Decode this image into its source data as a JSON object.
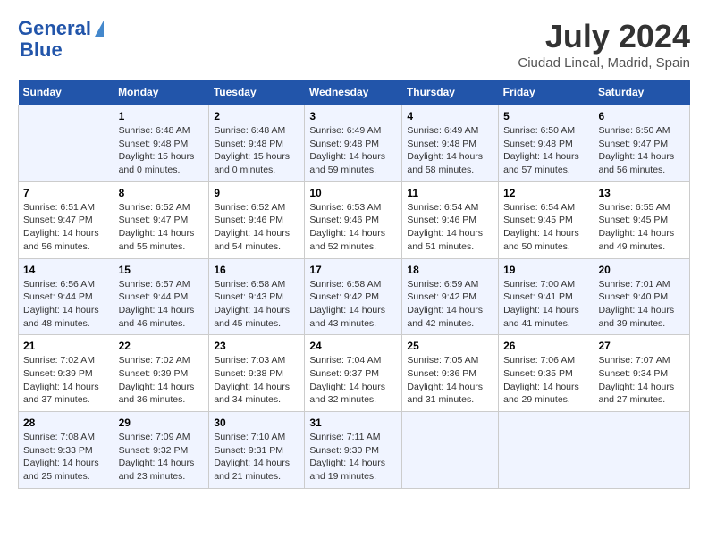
{
  "header": {
    "logo_line1": "General",
    "logo_line2": "Blue",
    "month_year": "July 2024",
    "location": "Ciudad Lineal, Madrid, Spain"
  },
  "days_of_week": [
    "Sunday",
    "Monday",
    "Tuesday",
    "Wednesday",
    "Thursday",
    "Friday",
    "Saturday"
  ],
  "weeks": [
    [
      {
        "day": "",
        "info": ""
      },
      {
        "day": "1",
        "info": "Sunrise: 6:48 AM\nSunset: 9:48 PM\nDaylight: 15 hours\nand 0 minutes."
      },
      {
        "day": "2",
        "info": "Sunrise: 6:48 AM\nSunset: 9:48 PM\nDaylight: 15 hours\nand 0 minutes."
      },
      {
        "day": "3",
        "info": "Sunrise: 6:49 AM\nSunset: 9:48 PM\nDaylight: 14 hours\nand 59 minutes."
      },
      {
        "day": "4",
        "info": "Sunrise: 6:49 AM\nSunset: 9:48 PM\nDaylight: 14 hours\nand 58 minutes."
      },
      {
        "day": "5",
        "info": "Sunrise: 6:50 AM\nSunset: 9:48 PM\nDaylight: 14 hours\nand 57 minutes."
      },
      {
        "day": "6",
        "info": "Sunrise: 6:50 AM\nSunset: 9:47 PM\nDaylight: 14 hours\nand 56 minutes."
      }
    ],
    [
      {
        "day": "7",
        "info": "Sunrise: 6:51 AM\nSunset: 9:47 PM\nDaylight: 14 hours\nand 56 minutes."
      },
      {
        "day": "8",
        "info": "Sunrise: 6:52 AM\nSunset: 9:47 PM\nDaylight: 14 hours\nand 55 minutes."
      },
      {
        "day": "9",
        "info": "Sunrise: 6:52 AM\nSunset: 9:46 PM\nDaylight: 14 hours\nand 54 minutes."
      },
      {
        "day": "10",
        "info": "Sunrise: 6:53 AM\nSunset: 9:46 PM\nDaylight: 14 hours\nand 52 minutes."
      },
      {
        "day": "11",
        "info": "Sunrise: 6:54 AM\nSunset: 9:46 PM\nDaylight: 14 hours\nand 51 minutes."
      },
      {
        "day": "12",
        "info": "Sunrise: 6:54 AM\nSunset: 9:45 PM\nDaylight: 14 hours\nand 50 minutes."
      },
      {
        "day": "13",
        "info": "Sunrise: 6:55 AM\nSunset: 9:45 PM\nDaylight: 14 hours\nand 49 minutes."
      }
    ],
    [
      {
        "day": "14",
        "info": "Sunrise: 6:56 AM\nSunset: 9:44 PM\nDaylight: 14 hours\nand 48 minutes."
      },
      {
        "day": "15",
        "info": "Sunrise: 6:57 AM\nSunset: 9:44 PM\nDaylight: 14 hours\nand 46 minutes."
      },
      {
        "day": "16",
        "info": "Sunrise: 6:58 AM\nSunset: 9:43 PM\nDaylight: 14 hours\nand 45 minutes."
      },
      {
        "day": "17",
        "info": "Sunrise: 6:58 AM\nSunset: 9:42 PM\nDaylight: 14 hours\nand 43 minutes."
      },
      {
        "day": "18",
        "info": "Sunrise: 6:59 AM\nSunset: 9:42 PM\nDaylight: 14 hours\nand 42 minutes."
      },
      {
        "day": "19",
        "info": "Sunrise: 7:00 AM\nSunset: 9:41 PM\nDaylight: 14 hours\nand 41 minutes."
      },
      {
        "day": "20",
        "info": "Sunrise: 7:01 AM\nSunset: 9:40 PM\nDaylight: 14 hours\nand 39 minutes."
      }
    ],
    [
      {
        "day": "21",
        "info": "Sunrise: 7:02 AM\nSunset: 9:39 PM\nDaylight: 14 hours\nand 37 minutes."
      },
      {
        "day": "22",
        "info": "Sunrise: 7:02 AM\nSunset: 9:39 PM\nDaylight: 14 hours\nand 36 minutes."
      },
      {
        "day": "23",
        "info": "Sunrise: 7:03 AM\nSunset: 9:38 PM\nDaylight: 14 hours\nand 34 minutes."
      },
      {
        "day": "24",
        "info": "Sunrise: 7:04 AM\nSunset: 9:37 PM\nDaylight: 14 hours\nand 32 minutes."
      },
      {
        "day": "25",
        "info": "Sunrise: 7:05 AM\nSunset: 9:36 PM\nDaylight: 14 hours\nand 31 minutes."
      },
      {
        "day": "26",
        "info": "Sunrise: 7:06 AM\nSunset: 9:35 PM\nDaylight: 14 hours\nand 29 minutes."
      },
      {
        "day": "27",
        "info": "Sunrise: 7:07 AM\nSunset: 9:34 PM\nDaylight: 14 hours\nand 27 minutes."
      }
    ],
    [
      {
        "day": "28",
        "info": "Sunrise: 7:08 AM\nSunset: 9:33 PM\nDaylight: 14 hours\nand 25 minutes."
      },
      {
        "day": "29",
        "info": "Sunrise: 7:09 AM\nSunset: 9:32 PM\nDaylight: 14 hours\nand 23 minutes."
      },
      {
        "day": "30",
        "info": "Sunrise: 7:10 AM\nSunset: 9:31 PM\nDaylight: 14 hours\nand 21 minutes."
      },
      {
        "day": "31",
        "info": "Sunrise: 7:11 AM\nSunset: 9:30 PM\nDaylight: 14 hours\nand 19 minutes."
      },
      {
        "day": "",
        "info": ""
      },
      {
        "day": "",
        "info": ""
      },
      {
        "day": "",
        "info": ""
      }
    ]
  ]
}
